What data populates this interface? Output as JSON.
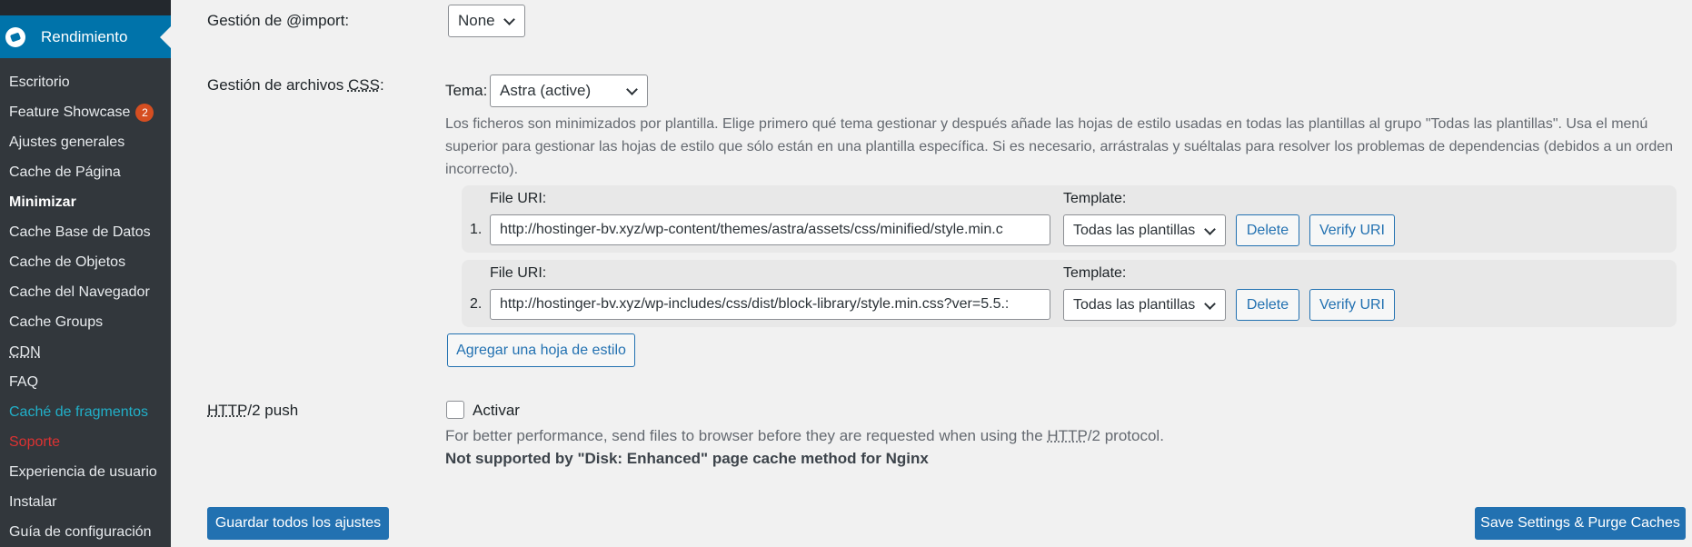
{
  "sidebar": {
    "current": "Rendimiento",
    "items": [
      {
        "label": "Escritorio"
      },
      {
        "label": "Feature Showcase",
        "badge": "2"
      },
      {
        "label": "Ajustes generales"
      },
      {
        "label": "Cache de Página"
      },
      {
        "label": "Minimizar"
      },
      {
        "label": "Cache Base de Datos"
      },
      {
        "label": "Cache de Objetos"
      },
      {
        "label": "Cache del Navegador"
      },
      {
        "label": "Cache Groups"
      },
      {
        "label": "CDN"
      },
      {
        "label": "FAQ"
      },
      {
        "label": "Caché de fragmentos"
      },
      {
        "label": "Soporte"
      },
      {
        "label": "Experiencia de usuario"
      },
      {
        "label": "Instalar"
      },
      {
        "label": "Guía de configuración"
      }
    ]
  },
  "import_row": {
    "label": "Gestión de @import:",
    "selected": "None"
  },
  "css_row": {
    "label_prefix": "Gestión de archivos ",
    "label_abbr": "CSS",
    "label_suffix": ":",
    "tema_label": "Tema:",
    "tema_selected": "Astra (active)",
    "description": "Los ficheros son minimizados por plantilla. Elige primero qué tema gestionar y después añade las hojas de estilo usadas en todas las plantillas al grupo \"Todas las plantillas\". Usa el menú superior para gestionar las hojas de estilo que sólo están en una plantilla específica. Si es necesario, arrástralas y suéltalas para resolver los problemas de dependencias (debidos a un orden incorrecto).",
    "files": [
      {
        "num": "1.",
        "uri_label": "File URI:",
        "uri": "http://hostinger-bv.xyz/wp-content/themes/astra/assets/css/minified/style.min.c",
        "template_label": "Template:",
        "template": "Todas las plantillas",
        "delete": "Delete",
        "verify": "Verify URI"
      },
      {
        "num": "2.",
        "uri_label": "File URI:",
        "uri": "http://hostinger-bv.xyz/wp-includes/css/dist/block-library/style.min.css?ver=5.5.:",
        "template_label": "Template:",
        "template": "Todas las plantillas",
        "delete": "Delete",
        "verify": "Verify URI"
      }
    ],
    "add_button": "Agregar una hoja de estilo"
  },
  "http2_row": {
    "label_abbr": "HTTP",
    "label_suffix": "/2 push",
    "checkbox_label": "Activar",
    "note_prefix": "For better performance, send files to browser before they are requested when using the ",
    "note_abbr": "HTTP",
    "note_suffix": "/2 protocol.",
    "warning": "Not supported by \"Disk: Enhanced\" page cache method for Nginx"
  },
  "footer": {
    "save_all": "Guardar todos los ajustes",
    "save_purge": "Save Settings & Purge Caches"
  }
}
